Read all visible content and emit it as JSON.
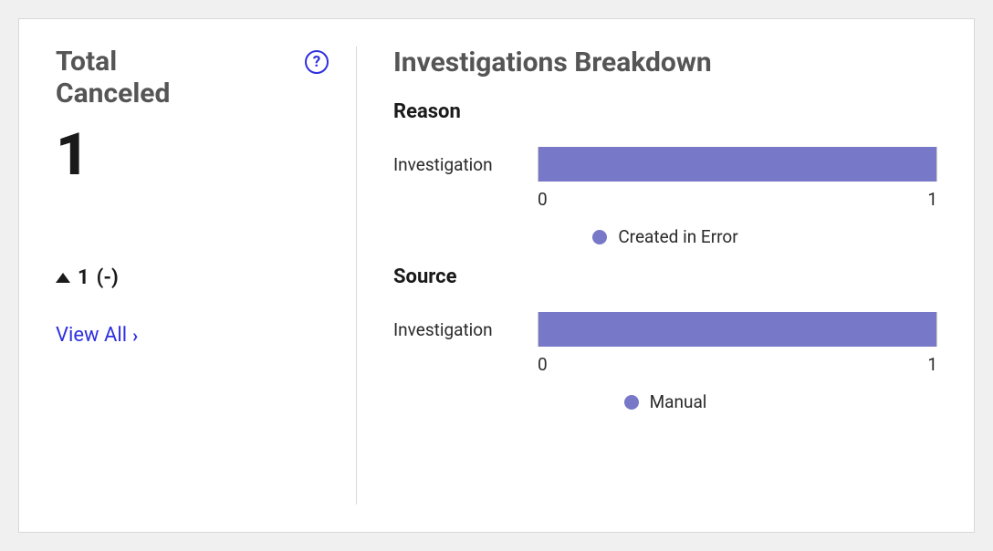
{
  "summary": {
    "title_line1": "Total",
    "title_line2": "Canceled",
    "value": "1",
    "delta_value": "1",
    "delta_suffix": "(-)",
    "view_all_label": "View All"
  },
  "breakdown": {
    "title": "Investigations Breakdown",
    "charts": [
      {
        "subtitle": "Reason",
        "row_label": "Investigation",
        "axis_min": "0",
        "axis_max": "1",
        "legend_label": "Created in Error"
      },
      {
        "subtitle": "Source",
        "row_label": "Investigation",
        "axis_min": "0",
        "axis_max": "1",
        "legend_label": "Manual"
      }
    ]
  },
  "colors": {
    "bar": "#7878c8",
    "link": "#2f2fe0",
    "heading": "#555555"
  },
  "chart_data": [
    {
      "type": "bar",
      "title": "Reason",
      "orientation": "horizontal",
      "categories": [
        "Investigation"
      ],
      "series": [
        {
          "name": "Created in Error",
          "values": [
            1
          ]
        }
      ],
      "xlabel": "",
      "ylabel": "",
      "xlim": [
        0,
        1
      ]
    },
    {
      "type": "bar",
      "title": "Source",
      "orientation": "horizontal",
      "categories": [
        "Investigation"
      ],
      "series": [
        {
          "name": "Manual",
          "values": [
            1
          ]
        }
      ],
      "xlabel": "",
      "ylabel": "",
      "xlim": [
        0,
        1
      ]
    }
  ]
}
